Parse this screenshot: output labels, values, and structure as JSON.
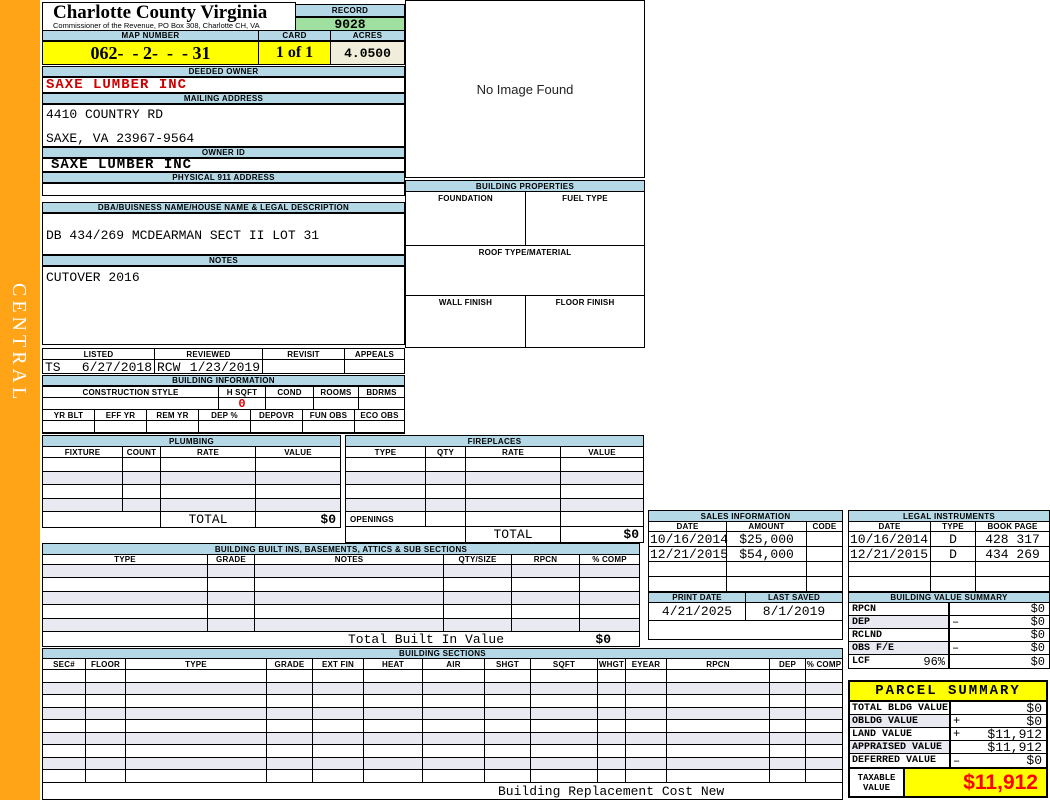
{
  "colors": {
    "sidebar_orange": "#FFA417",
    "header_blue": "#B5D8E6",
    "highlight_yellow": "#FFFF00",
    "record_green": "#9FDF9F",
    "acres_cream": "#F0EEDA",
    "owner_red": "#CC0000",
    "alert_red": "#FF0000"
  },
  "sidebar": {
    "label": "CENTRAL"
  },
  "header": {
    "county": "Charlotte County Virginia",
    "commissioner": "Commissioner of the Revenue, PO Box 308, Charlotte CH, VA",
    "record_label": "RECORD",
    "record_value": "9028",
    "map_label": "MAP NUMBER",
    "map_value": "062-  - 2-  -  - 31",
    "card_label": "CARD",
    "card_value": "1 of 1",
    "acres_label": "ACRES",
    "acres_value": "4.0500"
  },
  "owner": {
    "deeded_label": "DEEDED OWNER",
    "deeded_value": "SAXE LUMBER INC",
    "mailing_label": "MAILING ADDRESS",
    "mailing_line1": "4410 COUNTRY RD",
    "mailing_line2": "SAXE, VA 23967-9564",
    "owner_id_label": "OWNER ID",
    "owner_id_value": "SAXE LUMBER INC",
    "physical_label": "PHYSICAL 911 ADDRESS",
    "physical_value": ""
  },
  "description": {
    "dba_label": "DBA/BUISNESS NAME/HOUSE NAME & LEGAL DESCRIPTION",
    "dba_value": "DB 434/269 MCDEARMAN SECT II LOT 31",
    "notes_label": "NOTES",
    "notes_value": "CUTOVER 2016"
  },
  "review": {
    "listed_label": "LISTED",
    "listed_by": "TS",
    "listed_date": "6/27/2018",
    "reviewed_label": "REVIEWED",
    "reviewed_by": "RCW",
    "reviewed_date": "1/23/2019",
    "revisit_label": "REVISIT",
    "appeals_label": "APPEALS"
  },
  "building_information": {
    "title": "BUILDING INFORMATION",
    "row1_headers": [
      "CONSTRUCTION STYLE",
      "H SQFT",
      "COND",
      "ROOMS",
      "BDRMS"
    ],
    "hsqft_value": "0",
    "row2_headers": [
      "YR BLT",
      "EFF YR",
      "REM YR",
      "DEP %",
      "DEPOVR",
      "FUN OBS",
      "ECO OBS"
    ]
  },
  "plumbing": {
    "title": "PLUMBING",
    "headers": [
      "FIXTURE",
      "COUNT",
      "RATE",
      "VALUE"
    ],
    "total_label": "TOTAL",
    "total_value": "$0"
  },
  "fireplaces": {
    "title": "FIREPLACES",
    "headers": [
      "TYPE",
      "QTY",
      "RATE",
      "VALUE"
    ],
    "openings_label": "OPENINGS",
    "total_label": "TOTAL",
    "total_value": "$0"
  },
  "built_ins": {
    "title": "BUILDING BUILT INS, BASEMENTS, ATTICS & SUB SECTIONS",
    "headers": [
      "TYPE",
      "GRADE",
      "NOTES",
      "QTY/SIZE",
      "RPCN",
      "% COMP"
    ],
    "total_label": "Total Built In Value",
    "total_value": "$0"
  },
  "no_image": {
    "text": "No Image Found"
  },
  "building_properties": {
    "title": "BUILDING PROPERTIES",
    "foundation_label": "FOUNDATION",
    "fuel_label": "FUEL TYPE",
    "roof_label": "ROOF TYPE/MATERIAL",
    "wall_label": "WALL FINISH",
    "floor_label": "FLOOR FINISH"
  },
  "sales": {
    "title": "SALES INFORMATION",
    "headers": [
      "DATE",
      "AMOUNT",
      "CODE"
    ],
    "rows": [
      {
        "date": "10/16/2014",
        "amount": "$25,000",
        "code": ""
      },
      {
        "date": "12/21/2015",
        "amount": "$54,000",
        "code": ""
      }
    ]
  },
  "legal_instruments": {
    "title": "LEGAL INSTRUMENTS",
    "headers": [
      "DATE",
      "TYPE",
      "BOOK PAGE"
    ],
    "rows": [
      {
        "date": "10/16/2014",
        "type": "D",
        "book_page": "428 317"
      },
      {
        "date": "12/21/2015",
        "type": "D",
        "book_page": "434 269"
      }
    ]
  },
  "print_info": {
    "print_label": "PRINT DATE",
    "print_value": "4/21/2025",
    "saved_label": "LAST SAVED",
    "saved_value": "8/1/2019"
  },
  "value_summary": {
    "title": "BUILDING VALUE SUMMARY",
    "rows": [
      {
        "label": "RPCN",
        "pct": "",
        "op": "",
        "value": "$0"
      },
      {
        "label": "DEP",
        "pct": "",
        "op": "–",
        "value": "$0"
      },
      {
        "label": "RCLND",
        "pct": "",
        "op": "",
        "value": "$0"
      },
      {
        "label": "OBS F/E",
        "pct": "",
        "op": "–",
        "value": "$0"
      },
      {
        "label": "LCF",
        "pct": "96%",
        "op": "",
        "value": "$0"
      }
    ]
  },
  "building_sections": {
    "title": "BUILDING SECTIONS",
    "headers": [
      "SEC#",
      "FLOOR",
      "TYPE",
      "GRADE",
      "EXT FIN",
      "HEAT",
      "AIR",
      "SHGT",
      "SQFT",
      "WHGT",
      "EYEAR",
      "RPCN",
      "DEP",
      "% COMP"
    ],
    "footer": "Building Replacement Cost New"
  },
  "parcel_summary": {
    "title": "PARCEL SUMMARY",
    "rows": [
      {
        "label": "TOTAL BLDG VALUE",
        "op": "",
        "value": "$0"
      },
      {
        "label": "OBLDG VALUE",
        "op": "+",
        "value": "$0"
      },
      {
        "label": "LAND VALUE",
        "op": "+",
        "value": "$11,912"
      },
      {
        "label": "APPRAISED VALUE",
        "op": "",
        "value": "$11,912"
      },
      {
        "label": "DEFERRED VALUE",
        "op": "–",
        "value": "$0"
      }
    ],
    "taxable_label": "TAXABLE\nVALUE",
    "taxable_value": "$11,912"
  }
}
